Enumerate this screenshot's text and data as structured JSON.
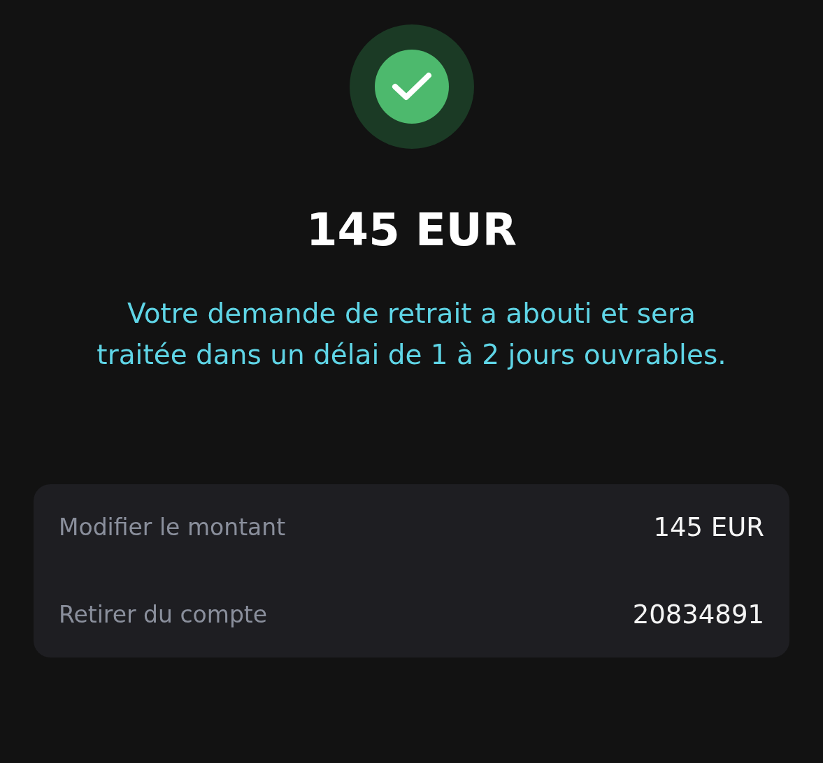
{
  "status": {
    "kind": "success"
  },
  "amount": "145 EUR",
  "message": "Votre demande de retrait a abouti et sera traitée dans un délai de 1 à 2 jours ouvrables.",
  "details": [
    {
      "label": "Modifier le montant",
      "value": "145 EUR"
    },
    {
      "label": "Retirer du compte",
      "value": "20834891"
    }
  ]
}
